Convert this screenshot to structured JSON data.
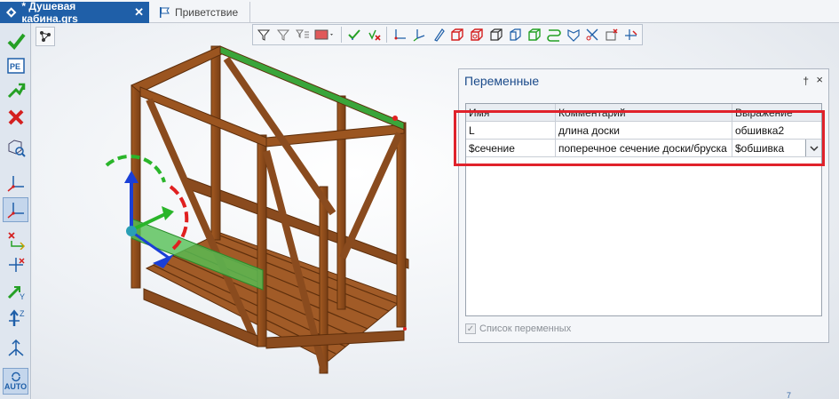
{
  "tabs": {
    "active_label": "* Душевая кабина.grs",
    "close_glyph": "✕",
    "welcome_label": "Приветствие"
  },
  "left_toolbar": [
    {
      "name": "ok-checkmark-icon"
    },
    {
      "name": "parameters-pe-icon",
      "text": "PE"
    },
    {
      "name": "apply-arrow-icon"
    },
    {
      "name": "cancel-x-icon"
    },
    {
      "name": "view-zoom-icon"
    },
    {
      "name": "axis-tripod-icon"
    },
    {
      "name": "axis-tripod-selected-icon"
    },
    {
      "name": "axis-x-icon"
    },
    {
      "name": "axis-move-icon"
    },
    {
      "name": "axis-y-icon",
      "text": "Y"
    },
    {
      "name": "axis-z-icon",
      "text": "Z"
    },
    {
      "name": "axis-rotate-icon"
    },
    {
      "name": "auto-icon",
      "text": "AUTO"
    }
  ],
  "variables_panel": {
    "title": "Переменные",
    "pin_glyph": "†",
    "close_glyph": "×",
    "columns": [
      "Имя",
      "Комментарий",
      "Выражение"
    ],
    "rows": [
      {
        "name": "L",
        "comment": "длина доски",
        "expression": "обшивка2"
      },
      {
        "name": "$сечение",
        "comment": "поперечное сечение доски/бруска",
        "expression": "$обшивка"
      }
    ],
    "checkbox_label": "Список переменных",
    "checkbox_checked": true
  },
  "corner_number": "7",
  "colors": {
    "accent": "#1f5fa8",
    "wood": "#8a4b1e",
    "wood_light": "#b86a2f",
    "highlight_box": "#e0222b",
    "gizmo_green": "#2ab52a",
    "gizmo_blue": "#1a3fd6",
    "gizmo_red": "#e02020"
  }
}
